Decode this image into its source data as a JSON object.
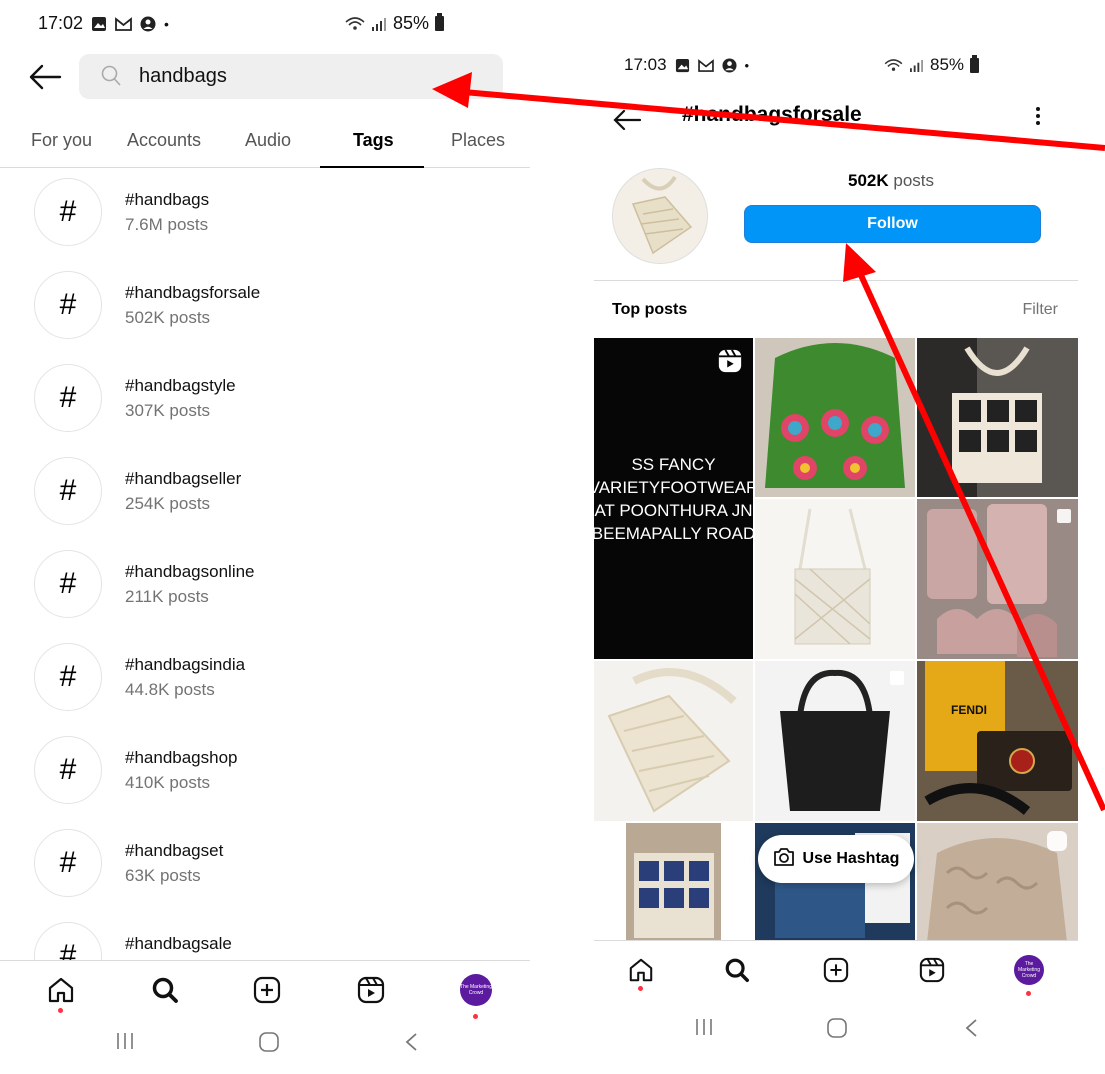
{
  "left": {
    "status": {
      "time": "17:02",
      "battery": "85%"
    },
    "search": {
      "query": "handbags"
    },
    "tabs": [
      {
        "label": "For you"
      },
      {
        "label": "Accounts"
      },
      {
        "label": "Audio"
      },
      {
        "label": "Tags",
        "active": true
      },
      {
        "label": "Places"
      }
    ],
    "tags": [
      {
        "name": "#handbags",
        "count": "7.6M posts"
      },
      {
        "name": "#handbagsforsale",
        "count": "502K posts"
      },
      {
        "name": "#handbagstyle",
        "count": "307K posts"
      },
      {
        "name": "#handbagseller",
        "count": "254K posts"
      },
      {
        "name": "#handbagsonline",
        "count": "211K posts"
      },
      {
        "name": "#handbagsindia",
        "count": "44.8K posts"
      },
      {
        "name": "#handbagshop",
        "count": "410K posts"
      },
      {
        "name": "#handbagset",
        "count": "63K posts"
      },
      {
        "name": "#handbagsale",
        "count": ""
      }
    ],
    "hash_symbol": "#"
  },
  "right": {
    "status": {
      "time": "17:03",
      "battery": "85%"
    },
    "header": {
      "title": "#handbagsforsale"
    },
    "posts_count": "502K",
    "posts_word": "posts",
    "follow_label": "Follow",
    "top_posts_label": "Top posts",
    "filter_label": "Filter",
    "reel_text": [
      "SS FANCY",
      "VARIETYFOOTWEAR",
      "AT POONTHURA JN",
      "BEEMAPALLY ROAD"
    ],
    "fendi_label": "FENDI",
    "use_hashtag_label": "Use Hashtag"
  },
  "avatar_text": "The Marketing Crowd",
  "colors": {
    "accent_blue": "#0095f6",
    "annotation_red": "#ff0000",
    "notification_dot": "#ff3040",
    "avatar_purple": "#5c1a9e"
  }
}
